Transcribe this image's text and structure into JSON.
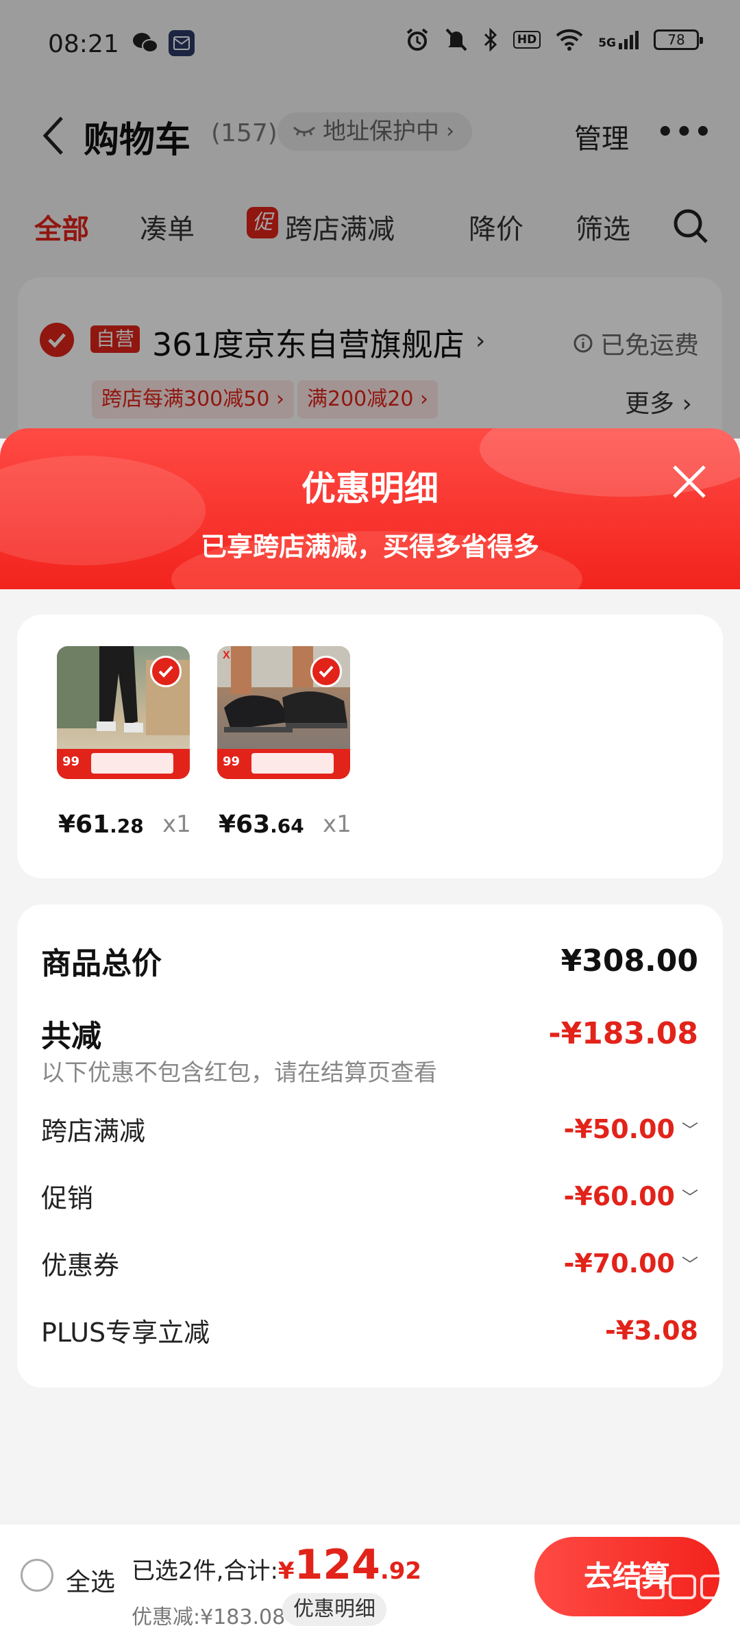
{
  "status_bar": {
    "time": "08:21",
    "battery": "78",
    "network": "5G",
    "hd": "HD"
  },
  "nav": {
    "title": "购物车",
    "count": "(157)",
    "address_protect": "地址保护中",
    "manage": "管理",
    "more": "•••"
  },
  "tabs": [
    {
      "label": "全部",
      "active": true
    },
    {
      "label": "凑单"
    },
    {
      "label": "跨店满减",
      "badge": "促"
    },
    {
      "label": "降价"
    },
    {
      "label": "筛选"
    }
  ],
  "store": {
    "tag": "自营",
    "name": "361度京东自营旗舰店",
    "shipping": "已免运费",
    "coupons": [
      "跨店每满300减50 ›",
      "满200减20 ›"
    ],
    "more": "更多 ›"
  },
  "sheet": {
    "title": "优惠明细",
    "subtitle": "已享跨店满减，买得多省得多"
  },
  "products": [
    {
      "price_main": "¥61",
      "price_dec": ".28",
      "qty": "x1",
      "band_text": "99"
    },
    {
      "price_main": "¥63",
      "price_dec": ".64",
      "qty": "x1",
      "band_text": "99"
    }
  ],
  "summary": {
    "total_label": "商品总价",
    "total_value": "¥308.00",
    "discount_label": "共减",
    "discount_value": "-¥183.08",
    "note": "以下优惠不包含红包，请在结算页查看",
    "items": [
      {
        "label": "跨店满减",
        "value": "-¥50.00",
        "expandable": true
      },
      {
        "label": "促销",
        "value": "-¥60.00",
        "expandable": true
      },
      {
        "label": "优惠券",
        "value": "-¥70.00",
        "expandable": true
      },
      {
        "label": "PLUS专享立减",
        "value": "-¥3.08",
        "expandable": false
      }
    ]
  },
  "bottom": {
    "select_all": "全选",
    "selected_text": "已选2件,合计:",
    "yen": "¥",
    "total_int": "124",
    "total_dec": ".92",
    "savings": "优惠减:¥183.08",
    "detail_button": "优惠明细",
    "checkout": "去结算"
  },
  "colors": {
    "accent": "#e2231a",
    "accent_light": "#ff4a44"
  }
}
